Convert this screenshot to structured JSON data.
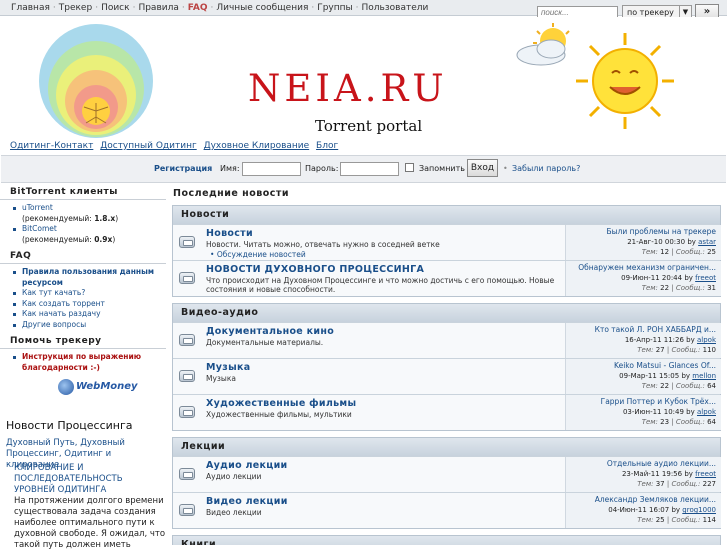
{
  "topnav": {
    "items": [
      "Главная",
      "Трекер",
      "Поиск",
      "Правила",
      "FAQ",
      "Личные сообщения",
      "Группы",
      "Пользователи"
    ]
  },
  "search": {
    "placeholder": "поиск...",
    "scope": "по трекеру",
    "go": "»"
  },
  "header": {
    "title": "NEIA.RU",
    "subtitle": "Torrent portal"
  },
  "links": [
    "Одитинг-Контакт",
    "Доступный Одитинг",
    "Духовное Клирование",
    "Блог"
  ],
  "login": {
    "register": "Регистрация",
    "name_label": "Имя:",
    "password_label": "Пароль:",
    "remember_label": "Запомнить",
    "submit": "Вход",
    "forgot": "Забыли пароль?"
  },
  "sidebar": {
    "clients_title": "BitTorrent клиенты",
    "clients": [
      {
        "name": "uTorrent",
        "rec": "(рекомендуемый:",
        "ver": "1.8.x",
        "close": ")"
      },
      {
        "name": "BitComet",
        "rec": "(рекомендуемый:",
        "ver": "0.9x",
        "close": ")"
      }
    ],
    "faq_title": "FAQ",
    "faq": [
      "Правила пользования данным ресурсом",
      "Как тут качать?",
      "Как создать торрент",
      "Как начать раздачу",
      "Другие вопросы"
    ],
    "help_title": "Помочь трекеру",
    "help_link": "Инструкция по выражению благодарности :-)",
    "webmoney": "WebMoney",
    "news_title": "Новости Процессинга",
    "news_links": "Духовный Путь, Духовный Процессинг, Одитинг и клирование",
    "news_item_title": "КЛИРОВАНИЕ И ПОСЛЕДОВАТЕЛЬНОСТЬ УРОВНЕЙ ОДИТИНГА",
    "news_item_text": "На протяжении долгого времени существовала задача создания наиболее оптимального пути к духовной свободе. Я ожидал, что такой путь должен иметь"
  },
  "main": {
    "heading": "Последние новости",
    "labels": {
      "by": "by",
      "topics": "Тем:",
      "posts": "Сообщ.:"
    },
    "categories": [
      {
        "title": "Новости",
        "forums": [
          {
            "name": "Новости",
            "desc": "Новости. Читать можно, отвечать нужно в соседней ветке",
            "sub": "Обсуждение новостей",
            "last_title": "Были проблемы на трекере",
            "last_date": "21-Авг-10 00:30",
            "last_user": "astar",
            "topics": "12",
            "posts": "25"
          },
          {
            "name": "НОВОСТИ ДУХОВНОГО ПРОЦЕССИНГА",
            "desc": "Что происходит на Духовном Процессинге и что можно достичь с его помощью. Новые состояния и новые способности.",
            "sub": "",
            "last_title": "Обнаружен механизм ограничен...",
            "last_date": "09-Июн-11 20:44",
            "last_user": "freeot",
            "topics": "22",
            "posts": "31"
          }
        ]
      },
      {
        "title": "Видео-аудио",
        "forums": [
          {
            "name": "Документальное кино",
            "desc": "Документальные материалы.",
            "sub": "",
            "last_title": "Кто такой Л. РОН ХАББАРД и...",
            "last_date": "16-Апр-11 11:26",
            "last_user": "alpok",
            "topics": "27",
            "posts": "110"
          },
          {
            "name": "Музыка",
            "desc": "Музыка",
            "sub": "",
            "last_title": "Keiko Matsui - Glances Of...",
            "last_date": "09-Мар-11 15:05",
            "last_user": "mellon",
            "topics": "22",
            "posts": "64"
          },
          {
            "name": "Художественные фильмы",
            "desc": "Художественные фильмы, мультики",
            "sub": "",
            "last_title": "Гарри Поттер и Кубок Трёх...",
            "last_date": "03-Июн-11 10:49",
            "last_user": "alpok",
            "topics": "23",
            "posts": "64"
          }
        ]
      },
      {
        "title": "Лекции",
        "forums": [
          {
            "name": "Аудио лекции",
            "desc": "Аудио лекции",
            "sub": "",
            "last_title": "Отдельные аудио лекции...",
            "last_date": "23-Май-11 19:56",
            "last_user": "freeot",
            "topics": "37",
            "posts": "227"
          },
          {
            "name": "Видео лекции",
            "desc": "Видео лекции",
            "sub": "",
            "last_title": "Александр Земляков лекции...",
            "last_date": "04-Июн-11 16:07",
            "last_user": "grog1000",
            "topics": "25",
            "posts": "114"
          }
        ]
      },
      {
        "title": "Книги",
        "forums": []
      }
    ]
  }
}
